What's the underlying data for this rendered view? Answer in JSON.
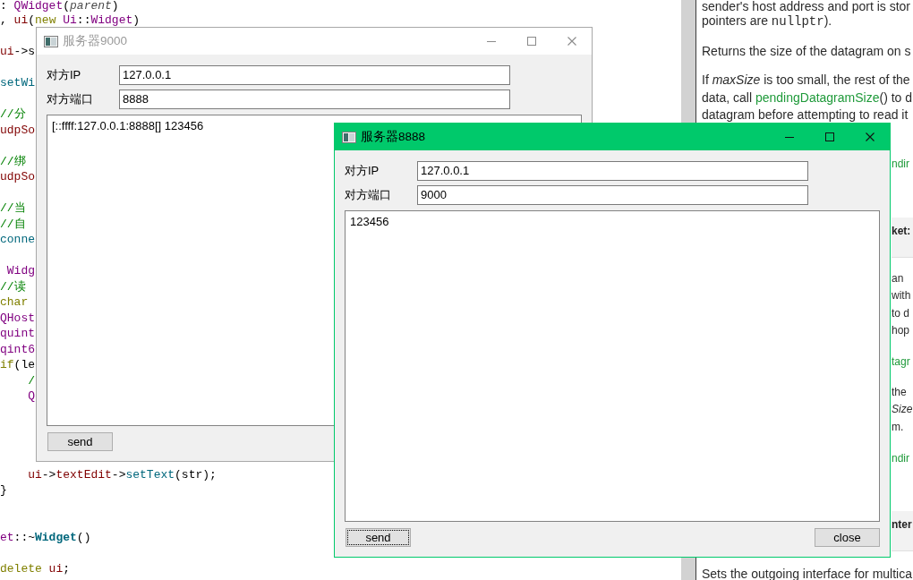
{
  "code_editor": {
    "lines": [
      {
        "kind": "code",
        "tokens": [
          {
            "kind": "plain",
            "text": ": "
          },
          {
            "kind": "type",
            "text": "QWidget"
          },
          {
            "kind": "plain",
            "text": "("
          },
          {
            "kind": "param",
            "text": "parent"
          },
          {
            "kind": "plain",
            "text": ")"
          }
        ]
      },
      {
        "kind": "code",
        "tokens": [
          {
            "kind": "plain",
            "text": ", "
          },
          {
            "kind": "member",
            "text": "ui"
          },
          {
            "kind": "plain",
            "text": "("
          },
          {
            "kind": "keyword",
            "text": "new "
          },
          {
            "kind": "type",
            "text": "Ui"
          },
          {
            "kind": "plain",
            "text": "::"
          },
          {
            "kind": "type",
            "text": "Widget"
          },
          {
            "kind": "plain",
            "text": ")"
          }
        ]
      },
      {
        "kind": "blank"
      },
      {
        "kind": "code",
        "tokens": [
          {
            "kind": "member",
            "text": "ui"
          },
          {
            "kind": "plain",
            "text": "->s"
          }
        ]
      },
      {
        "kind": "blank"
      },
      {
        "kind": "code",
        "tokens": [
          {
            "kind": "function",
            "text": "setWi"
          }
        ]
      },
      {
        "kind": "blank"
      },
      {
        "kind": "code",
        "tokens": [
          {
            "kind": "comment",
            "text": "//分"
          }
        ]
      },
      {
        "kind": "code",
        "tokens": [
          {
            "kind": "member",
            "text": "udpSo"
          }
        ]
      },
      {
        "kind": "blank"
      },
      {
        "kind": "code",
        "tokens": [
          {
            "kind": "comment",
            "text": "//绑"
          }
        ]
      },
      {
        "kind": "code",
        "tokens": [
          {
            "kind": "member",
            "text": "udpSo"
          }
        ]
      },
      {
        "kind": "blank"
      },
      {
        "kind": "code",
        "tokens": [
          {
            "kind": "comment",
            "text": "//当"
          }
        ]
      },
      {
        "kind": "code",
        "tokens": [
          {
            "kind": "comment",
            "text": "//自"
          }
        ]
      },
      {
        "kind": "code",
        "tokens": [
          {
            "kind": "function",
            "text": "conne"
          }
        ]
      },
      {
        "kind": "blank"
      },
      {
        "kind": "code",
        "tokens": [
          {
            "kind": "type",
            "text": " Widg"
          }
        ]
      },
      {
        "kind": "code",
        "tokens": [
          {
            "kind": "comment",
            "text": "//读"
          }
        ]
      },
      {
        "kind": "code",
        "tokens": [
          {
            "kind": "keyword",
            "text": "char"
          }
        ]
      },
      {
        "kind": "code",
        "tokens": [
          {
            "kind": "type",
            "text": "QHost"
          }
        ]
      },
      {
        "kind": "code",
        "tokens": [
          {
            "kind": "type",
            "text": "quint"
          }
        ]
      },
      {
        "kind": "code",
        "tokens": [
          {
            "kind": "type",
            "text": "qint6"
          }
        ]
      },
      {
        "kind": "code",
        "tokens": [
          {
            "kind": "keyword",
            "text": "if"
          },
          {
            "kind": "plain",
            "text": "(le"
          }
        ]
      },
      {
        "kind": "code",
        "tokens": [
          {
            "kind": "comment",
            "text": "    /"
          }
        ]
      },
      {
        "kind": "code",
        "tokens": [
          {
            "kind": "type",
            "text": "    Q"
          }
        ]
      },
      {
        "kind": "blank"
      },
      {
        "kind": "blank"
      },
      {
        "kind": "blank"
      },
      {
        "kind": "blank"
      },
      {
        "kind": "code",
        "tokens": [
          {
            "kind": "member",
            "text": "    ui"
          },
          {
            "kind": "plain",
            "text": "->"
          },
          {
            "kind": "member",
            "text": "textEdit"
          },
          {
            "kind": "plain",
            "text": "->"
          },
          {
            "kind": "function",
            "text": "setText"
          },
          {
            "kind": "plain",
            "text": "(str);"
          }
        ]
      },
      {
        "kind": "code",
        "tokens": [
          {
            "kind": "plain",
            "text": "}"
          }
        ]
      },
      {
        "kind": "blank"
      },
      {
        "kind": "blank"
      },
      {
        "kind": "code",
        "tokens": [
          {
            "kind": "type",
            "text": "et"
          },
          {
            "kind": "plain",
            "text": "::~"
          },
          {
            "kind": "definition",
            "text": "Widget"
          },
          {
            "kind": "plain",
            "text": "()"
          }
        ]
      },
      {
        "kind": "blank"
      },
      {
        "kind": "code",
        "tokens": [
          {
            "kind": "keyword",
            "text": "delete "
          },
          {
            "kind": "member",
            "text": "ui"
          },
          {
            "kind": "plain",
            "text": ";"
          }
        ]
      }
    ]
  },
  "doc_panel": {
    "top_paragraphs": [
      {
        "lines": [
          [
            {
              "kind": "text",
              "text": "sender's host address and port is stor"
            }
          ],
          [
            {
              "kind": "text",
              "text": "pointers are "
            },
            {
              "kind": "code",
              "text": "nullptr"
            },
            {
              "kind": "text",
              "text": ")."
            }
          ]
        ]
      },
      {
        "lines": [
          [
            {
              "kind": "text",
              "text": "Returns the size of the datagram on s"
            }
          ]
        ]
      },
      {
        "lines": [
          [
            {
              "kind": "text",
              "text": "If *maxSize* is too small, the rest of the"
            }
          ],
          [
            {
              "kind": "text",
              "text": "data, call "
            },
            {
              "kind": "link",
              "text": "pendingDatagramSize"
            },
            {
              "kind": "text",
              "text": "() to d"
            }
          ],
          [
            {
              "kind": "text",
              "text": "datagram before attempting to read it"
            }
          ]
        ]
      }
    ],
    "right_fragments": [
      {
        "kind": "link",
        "lines": [
          "ndir"
        ]
      },
      {
        "kind": "heading",
        "lines": [
          "ket:"
        ]
      },
      {
        "kind": "text",
        "lines": [
          "an",
          "with",
          "to d",
          "hop"
        ]
      },
      {
        "kind": "link",
        "lines": [
          "tagr"
        ]
      },
      {
        "kind": "text",
        "lines": [
          "the",
          "*Size*",
          "m."
        ]
      },
      {
        "kind": "link",
        "lines": [
          "ndir"
        ]
      },
      {
        "kind": "heading",
        "lines": [
          "nter"
        ]
      }
    ],
    "bottom_paragraphs": [
      {
        "lines": [
          [
            {
              "kind": "text",
              "text": "Sets the outgoing interface for multica"
            }
          ]
        ]
      }
    ]
  },
  "windows": [
    {
      "title": "服务器9000",
      "active": false,
      "fields": [
        {
          "label": "对方IP",
          "value": "127.0.0.1"
        },
        {
          "label": "对方端口",
          "value": "8888"
        }
      ],
      "message_area": {
        "text": "[::ffff:127.0.0.1:8888[] 123456"
      },
      "buttons": [
        {
          "label": "send",
          "focused": false
        }
      ]
    },
    {
      "title": "服务器8888",
      "active": true,
      "fields": [
        {
          "label": "对方IP",
          "value": "127.0.0.1"
        },
        {
          "label": "对方端口",
          "value": "9000"
        }
      ],
      "message_area": {
        "text": "123456"
      },
      "buttons": [
        {
          "label": "send",
          "focused": true
        },
        {
          "label": "close",
          "focused": false
        }
      ]
    }
  ]
}
